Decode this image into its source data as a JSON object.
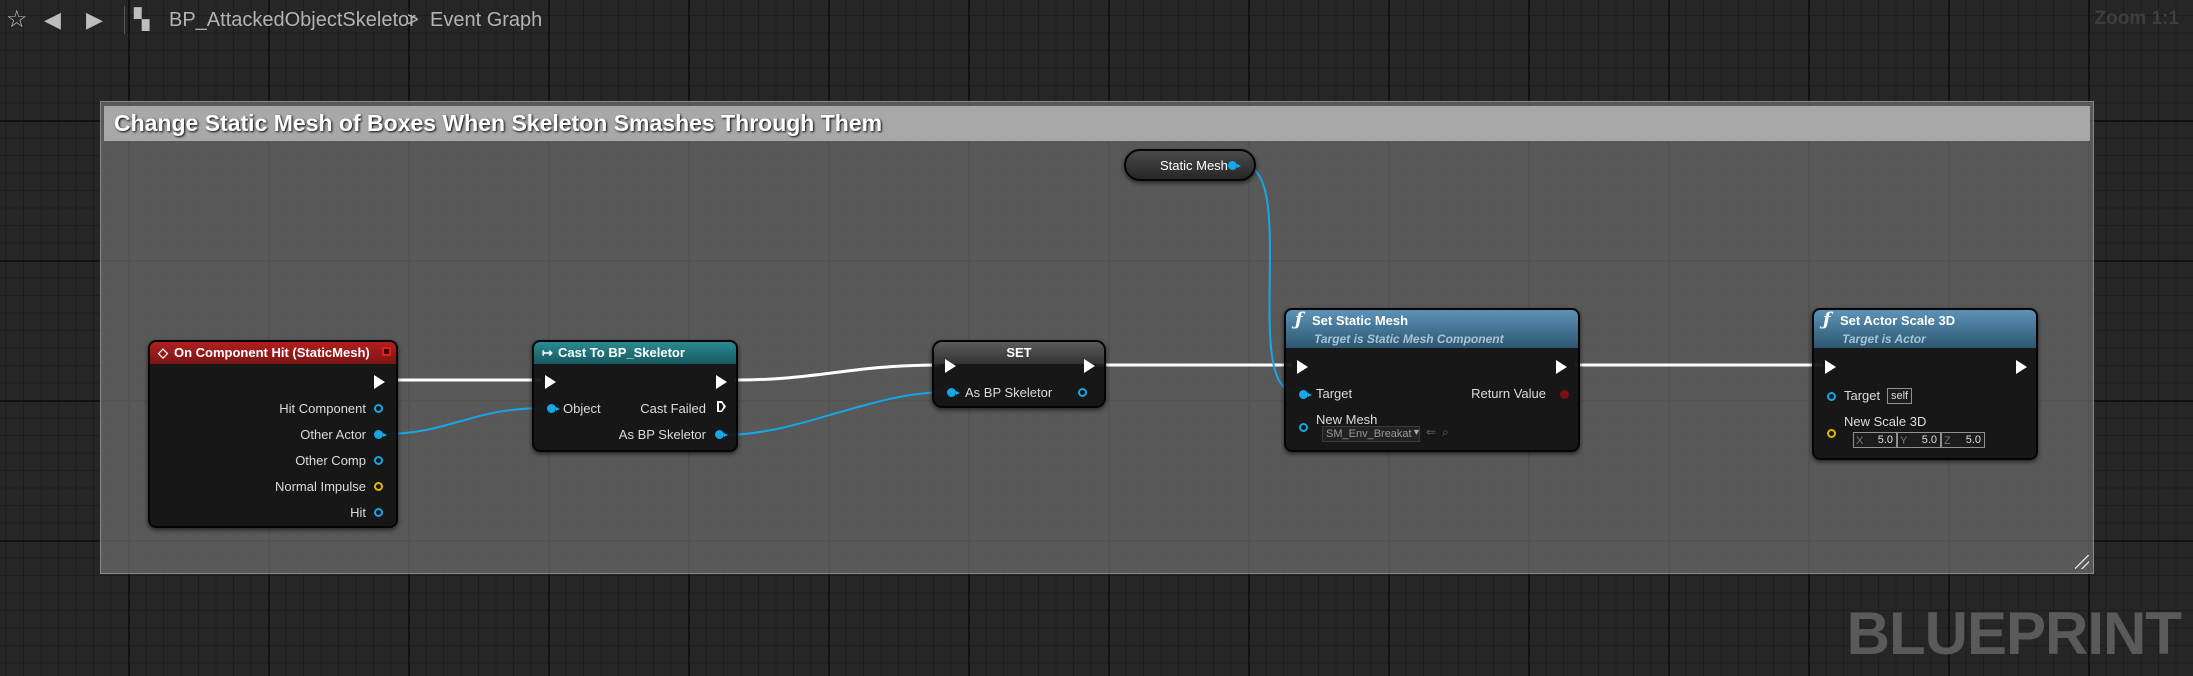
{
  "toolbar": {
    "breadcrumb_blueprint": "BP_AttackedObjectSkeletor",
    "breadcrumb_separator": ">",
    "breadcrumb_graph": "Event Graph",
    "zoom": "Zoom 1:1",
    "icons": [
      "star-icon",
      "back-arrow-icon",
      "forward-arrow-icon",
      "graph-icon"
    ]
  },
  "watermark": "BLUEPRINT",
  "comment": {
    "title": "Change Static Mesh of Boxes When Skeleton Smashes Through Them"
  },
  "nodes": {
    "event": {
      "title": "On Component Hit (StaticMesh)",
      "pins": [
        "Hit Component",
        "Other Actor",
        "Other Comp",
        "Normal Impulse",
        "Hit"
      ],
      "header_color": "#9c1b1b"
    },
    "cast": {
      "title": "Cast To BP_Skeletor",
      "input_object": "Object",
      "cast_failed": "Cast Failed",
      "output": "As BP Skeletor",
      "header_color": "#1e6a71"
    },
    "set": {
      "title": "SET",
      "pin": "As BP Skeletor"
    },
    "static_mesh_var": {
      "label": "Static Mesh"
    },
    "set_static_mesh": {
      "title": "Set Static Mesh",
      "subtitle": "Target is Static Mesh Component",
      "target": "Target",
      "return_value": "Return Value",
      "new_mesh": "New Mesh",
      "new_mesh_value": "SM_Env_Breakat"
    },
    "set_actor_scale": {
      "title": "Set Actor Scale 3D",
      "subtitle": "Target is Actor",
      "target": "Target",
      "target_value": "self",
      "new_scale": "New Scale 3D",
      "x_label": "X",
      "x": "5.0",
      "y_label": "Y",
      "y": "5.0",
      "z_label": "Z",
      "z": "5.0"
    }
  },
  "colors": {
    "exec_wire": "#ffffff",
    "object_wire": "#15a8e9",
    "vector_pin": "#e6b300",
    "function_header": "#4a7fa6"
  }
}
